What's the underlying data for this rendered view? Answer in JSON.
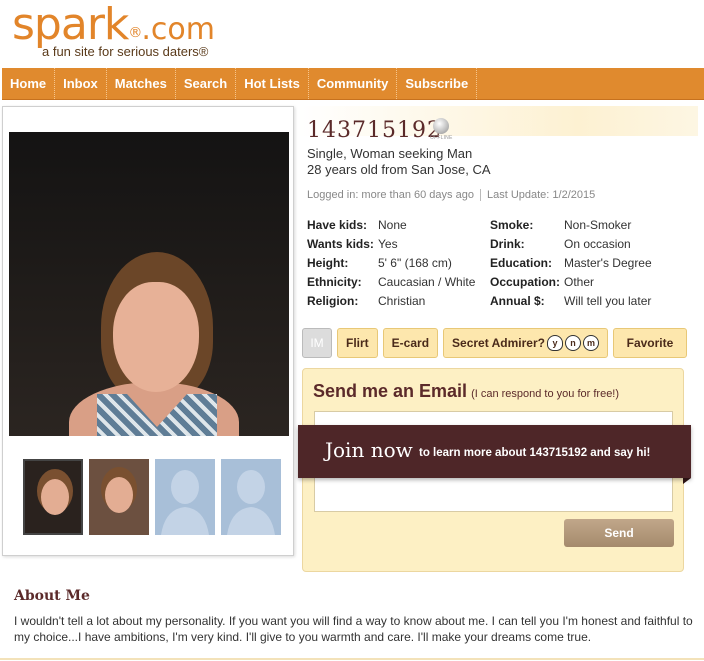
{
  "brand": {
    "logo_main": "spark",
    "logo_reg": "®",
    "logo_dotcom": ".com",
    "tagline": "a fun site for serious daters®",
    "accent": "#e08a2e"
  },
  "nav": {
    "items": [
      "Home",
      "Inbox",
      "Matches",
      "Search",
      "Hot Lists",
      "Community",
      "Subscribe"
    ]
  },
  "profile": {
    "username": "143715192",
    "status": "OFFLINE",
    "headline": "Single, Woman seeking Man",
    "age_location": "28 years old from San Jose, CA",
    "logged_in": "Logged in: more than 60 days ago",
    "last_update": "Last Update: 1/2/2015",
    "attrs_left": [
      {
        "k": "Have kids:",
        "v": "None"
      },
      {
        "k": "Wants kids:",
        "v": "Yes"
      },
      {
        "k": "Height:",
        "v": "5' 6\" (168 cm)"
      },
      {
        "k": "Ethnicity:",
        "v": "Caucasian / White"
      },
      {
        "k": "Religion:",
        "v": "Christian"
      }
    ],
    "attrs_right": [
      {
        "k": "Smoke:",
        "v": "Non-Smoker"
      },
      {
        "k": "Drink:",
        "v": "On occasion"
      },
      {
        "k": "Education:",
        "v": "Master's Degree"
      },
      {
        "k": "Occupation:",
        "v": "Other"
      },
      {
        "k": "Annual $:",
        "v": "Will tell you later"
      }
    ]
  },
  "actions": {
    "im": "IM",
    "flirt": "Flirt",
    "ecard": "E-card",
    "secret_admirer": "Secret Admirer?",
    "yes": "y",
    "no": "n",
    "maybe": "m",
    "favorite": "Favorite"
  },
  "email": {
    "title": "Send me an Email",
    "subtitle": "(I can respond to you for free!)",
    "send": "Send"
  },
  "join": {
    "big": "Join now",
    "text": "to learn more about 143715192 and say hi!"
  },
  "about": {
    "heading": "About Me",
    "body": "I wouldn't tell a lot about my personality. If you want you will find a way to know about me. I can tell you I'm honest and faithful to my choice...I have ambitions, I'm very kind. I'll give to you warmth and care. I'll make your dreams come true."
  }
}
